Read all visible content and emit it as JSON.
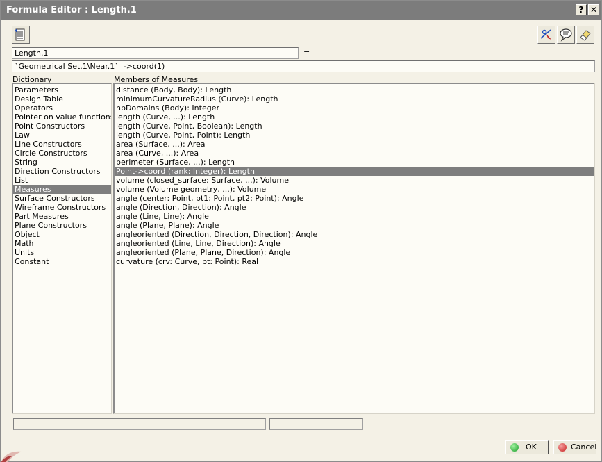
{
  "window": {
    "title": "Formula Editor : Length.1",
    "help_label": "?",
    "close_label": "✕"
  },
  "toolbar": {
    "import_icon": "import-list-icon",
    "select_icon": "select-pointer-icon",
    "comment_icon": "speech-bubble-icon",
    "eraser_icon": "eraser-icon"
  },
  "parameter": {
    "name": "Length.1",
    "equals": "="
  },
  "formula": {
    "value": "`Geometrical Set.1\\Near.1`  ->coord(1)"
  },
  "dictionary": {
    "header": "Dictionary",
    "items": [
      "Parameters",
      "Design Table",
      "Operators",
      "Pointer on value functions",
      "Point Constructors",
      "Law",
      "Line Constructors",
      "Circle Constructors",
      "String",
      "Direction Constructors",
      "List",
      "Measures",
      "Surface Constructors",
      "Wireframe Constructors",
      "Part Measures",
      "Plane Constructors",
      "Object",
      "Math",
      "Units",
      "Constant"
    ],
    "selected_index": 11
  },
  "members": {
    "header": "Members of Measures",
    "items": [
      "distance (Body, Body): Length",
      "minimumCurvatureRadius (Curve): Length",
      "nbDomains (Body): Integer",
      "length (Curve, ...): Length",
      "length (Curve, Point, Boolean): Length",
      "length (Curve, Point, Point): Length",
      "area (Surface, ...): Area",
      "area (Curve, ...): Area",
      "perimeter (Surface, ...): Length",
      "Point->coord (rank: Integer): Length",
      "volume (closed_surface: Surface, ...): Volume",
      "volume (Volume geometry, ...): Volume",
      "angle (center: Point, pt1: Point, pt2: Point): Angle",
      "angle (Direction, Direction): Angle",
      "angle (Line, Line): Angle",
      "angle (Plane, Plane): Angle",
      "angleoriented (Direction, Direction, Direction): Angle",
      "angleoriented (Line, Line, Direction): Angle",
      "angleoriented (Plane, Plane, Direction): Angle",
      "curvature (crv: Curve, pt: Point): Real"
    ],
    "selected_index": 9
  },
  "buttons": {
    "ok_label": "OK",
    "cancel_label": "Cancel",
    "ok_color": "#1a9e2a",
    "cancel_color": "#c81e1e"
  },
  "colors": {
    "titlebar": "#7c7c7c",
    "selection": "#7e7e7e",
    "background": "#f4f1e6"
  }
}
